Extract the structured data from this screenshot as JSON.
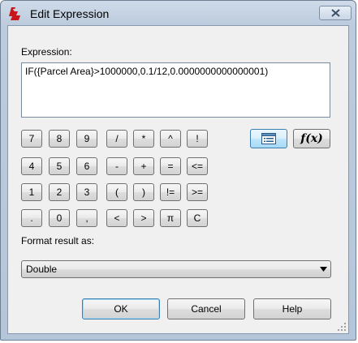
{
  "window": {
    "title": "Edit Expression",
    "icons": {
      "app": "app-logo-icon",
      "close": "close-icon",
      "view": "list-view-icon",
      "grip": "resize-grip-icon"
    }
  },
  "expression": {
    "label": "Expression:",
    "value": "IF({Parcel Area}>1000000,0.1/12,0.0000000000000001)"
  },
  "keypad": {
    "rows": [
      [
        "7",
        "8",
        "9",
        "/",
        "*",
        "^",
        "!"
      ],
      [
        "4",
        "5",
        "6",
        "-",
        "+",
        "=",
        "<="
      ],
      [
        "1",
        "2",
        "3",
        "(",
        ")",
        "!=",
        ">="
      ],
      [
        ".",
        "0",
        ",",
        "<",
        ">",
        "π",
        "C"
      ]
    ]
  },
  "tools": {
    "function_label": "f(x)"
  },
  "format": {
    "label": "Format result as:",
    "selected": "Double"
  },
  "buttons": {
    "ok": "OK",
    "cancel": "Cancel",
    "help": "Help"
  },
  "colors": {
    "accent": "#3c7fb1",
    "title_bg": "#bccbdd"
  }
}
